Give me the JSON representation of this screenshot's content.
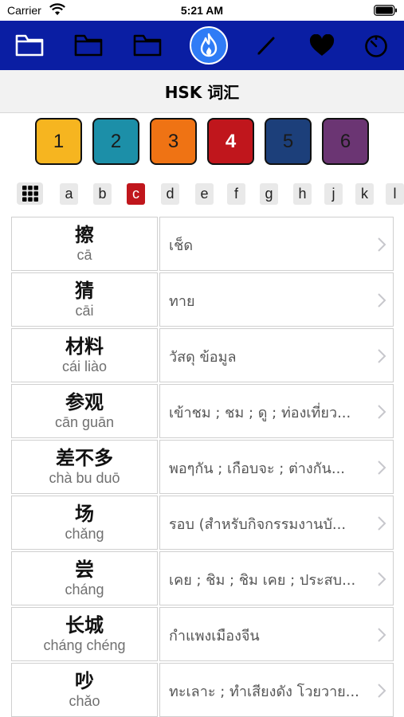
{
  "status_bar": {
    "carrier": "Carrier",
    "time": "5:21 AM"
  },
  "nav": {
    "icons": [
      "folder-icon",
      "folder-icon",
      "folder-icon",
      "flame-icon",
      "pencil-icon",
      "heart-icon",
      "timer-icon"
    ],
    "active_index": 3
  },
  "header": {
    "title": "HSK 词汇"
  },
  "levels": [
    {
      "label": "1",
      "color": "#f6b520"
    },
    {
      "label": "2",
      "color": "#1c8fa8"
    },
    {
      "label": "3",
      "color": "#ef7314"
    },
    {
      "label": "4",
      "color": "#c0161c",
      "selected": true
    },
    {
      "label": "5",
      "color": "#1c3f7a"
    },
    {
      "label": "6",
      "color": "#6b3573"
    }
  ],
  "letters": {
    "items": [
      "a",
      "b",
      "c",
      "d",
      "e",
      "f",
      "g",
      "h",
      "j",
      "k",
      "l"
    ],
    "selected": "c"
  },
  "words": [
    {
      "hanzi": "擦",
      "pinyin": "cā",
      "meaning": "เช็ด"
    },
    {
      "hanzi": "猜",
      "pinyin": "cāi",
      "meaning": "ทาย"
    },
    {
      "hanzi": "材料",
      "pinyin": "cái liào",
      "meaning": "วัสดุ ข้อมูล"
    },
    {
      "hanzi": "参观",
      "pinyin": "cān guān",
      "meaning": "เข้าชม ; ชม ; ดู ; ท่องเที่ยว..."
    },
    {
      "hanzi": "差不多",
      "pinyin": "chà bu duō",
      "meaning": "พอๆกัน ; เกือบจะ ; ต่างกัน..."
    },
    {
      "hanzi": "场",
      "pinyin": "chǎng",
      "meaning": "รอบ (สำหรับกิจกรรมงานบั..."
    },
    {
      "hanzi": "尝",
      "pinyin": "cháng",
      "meaning": "เคย ; ชิม ; ชิม เคย ; ประสบ..."
    },
    {
      "hanzi": "长城",
      "pinyin": "cháng chéng",
      "meaning": "กำแพงเมืองจีน"
    },
    {
      "hanzi": "吵",
      "pinyin": "chǎo",
      "meaning": "ทะเลาะ ; ทำเสียงดัง โวยวาย..."
    }
  ]
}
